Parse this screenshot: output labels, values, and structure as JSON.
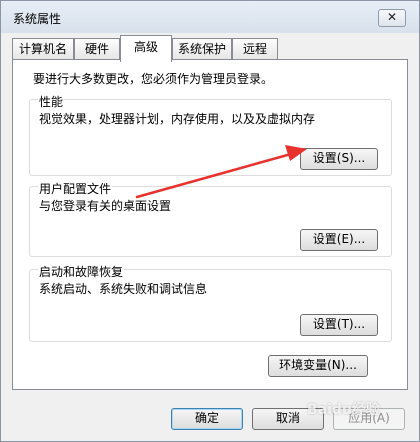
{
  "window": {
    "title": "系统属性",
    "close_label": "✕"
  },
  "tabs": [
    {
      "label": "计算机名"
    },
    {
      "label": "硬件"
    },
    {
      "label": "高级"
    },
    {
      "label": "系统保护"
    },
    {
      "label": "远程"
    }
  ],
  "advanced": {
    "admin_notice": "要进行大多数更改，您必须作为管理员登录。",
    "performance": {
      "title": "性能",
      "description": "视觉效果，处理器计划，内存使用，以及及虚拟内存",
      "button": "设置(S)..."
    },
    "user_profiles": {
      "title": "用户配置文件",
      "description": "与您登录有关的桌面设置",
      "button": "设置(E)..."
    },
    "startup_recovery": {
      "title": "启动和故障恢复",
      "description": "系统启动、系统失败和调试信息",
      "button": "设置(T)..."
    },
    "env_button": "环境变量(N)..."
  },
  "footer": {
    "ok": "确定",
    "cancel": "取消",
    "apply": "应用(A)"
  },
  "colors": {
    "annotation_arrow": "#e8322e"
  },
  "watermark": "Baidu经验"
}
